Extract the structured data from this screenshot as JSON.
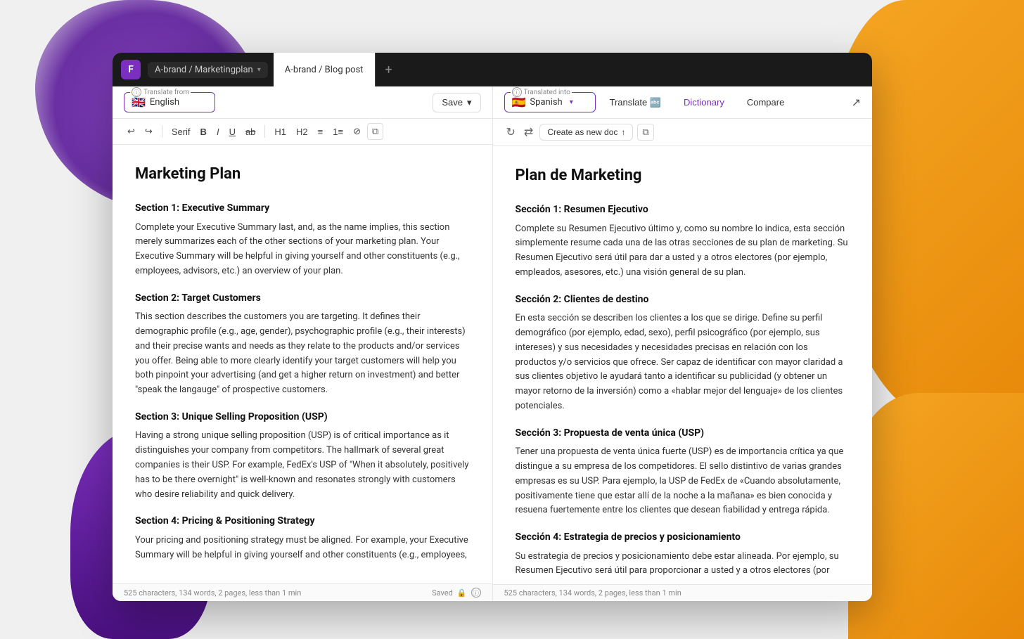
{
  "background": {
    "colors": {
      "purple": "#7B2FBE",
      "orange": "#F5A623",
      "dark": "#1a1a1a"
    }
  },
  "titleBar": {
    "logo": "F",
    "project": "A-brand / Marketingplan",
    "tabs": [
      {
        "label": "A-brand / Blog post",
        "active": true
      }
    ],
    "addTab": "+"
  },
  "leftPanel": {
    "toolbar": {
      "translateFrom": "Translate from",
      "languageFlag": "🇬🇧",
      "languageName": "English",
      "saveLabel": "Save",
      "infoIcon": "ⓘ"
    },
    "formatToolbar": {
      "undo": "↩",
      "redo": "↪",
      "fontLabel": "Serif",
      "bold": "B",
      "italic": "I",
      "underline": "U",
      "strikethrough": "S̶",
      "h1": "H1",
      "h2": "H2",
      "bulletList": "•≡",
      "numberedList": "1≡",
      "clearFormat": "✕",
      "copyFormat": "⧉"
    },
    "document": {
      "title": "Marketing Plan",
      "sections": [
        {
          "heading": "Section 1: Executive Summary",
          "text": "Complete your Executive Summary last, and, as the name implies, this section merely summarizes each of the other sections of your marketing plan. Your Executive Summary will be helpful in giving yourself and other constituents (e.g., employees, advisors, etc.) an overview of your plan."
        },
        {
          "heading": "Section 2: Target Customers",
          "text": "This section describes the customers you are targeting. It defines their demographic profile (e.g., age, gender), psychographic profile (e.g., their interests) and their precise wants and needs as they relate to the products and/or services you offer. Being able to more clearly identify your target customers will help you both pinpoint your advertising (and get a higher return on investment) and better \"speak the langauge\" of prospective customers."
        },
        {
          "heading": "Section 3: Unique Selling Proposition (USP)",
          "text": "Having a strong unique selling proposition (USP) is of critical importance as it distinguishes your company from competitors. The hallmark of several great companies is their USP. For example, FedEx's USP of \"When it absolutely, positively has to be there overnight\" is well-known and resonates strongly with customers who desire reliability and quick delivery."
        },
        {
          "heading": "Section 4: Pricing & Positioning Strategy",
          "text": "Your pricing and positioning strategy must be aligned. For example, your Executive Summary will be helpful in giving yourself and other constituents (e.g., employees,"
        }
      ]
    },
    "statusBar": {
      "stats": "525 characters, 134 words, 2 pages, less than 1 min",
      "savedLabel": "Saved",
      "lockIcon": "🔒"
    }
  },
  "rightPanel": {
    "toolbar": {
      "translatedInto": "Translated into",
      "languageFlag": "🇪🇸",
      "languageName": "Spanish",
      "translateLabel": "Translate",
      "translateIcon": "🔤",
      "dictionaryLabel": "Dictionary",
      "compareLabel": "Compare",
      "exportIcon": "↗",
      "infoIcon": "ⓘ"
    },
    "formatToolbar": {
      "refreshIcon": "↻",
      "syncIcon": "⇄",
      "createNewLabel": "Create as new doc",
      "uploadIcon": "↑",
      "copyIcon": "⧉"
    },
    "document": {
      "title": "Plan de Marketing",
      "sections": [
        {
          "heading": "Sección 1: Resumen Ejecutivo",
          "text": "Complete su Resumen Ejecutivo último y, como su nombre lo indica, esta sección simplemente resume cada una de las otras secciones de su plan de marketing. Su Resumen Ejecutivo será útil para dar a usted y a otros electores (por ejemplo, empleados, asesores, etc.) una visión general de su plan."
        },
        {
          "heading": "Sección 2: Clientes de destino",
          "text": "En esta sección se describen los clientes a los que se dirige. Define su perfil demográfico (por ejemplo, edad, sexo), perfil psicográfico (por ejemplo, sus intereses) y sus necesidades y necesidades precisas en relación con los productos y/o servicios que ofrece. Ser capaz de identificar con mayor claridad a sus clientes objetivo le ayudará tanto a identificar su publicidad (y obtener un mayor retorno de la inversión) como a «hablar mejor del lenguaje» de los clientes potenciales."
        },
        {
          "heading": "Sección 3: Propuesta de venta única (USP)",
          "text": "Tener una propuesta de venta única fuerte (USP) es de importancia crítica ya que distingue a su empresa de los competidores. El sello distintivo de varias grandes empresas es su USP. Para ejemplo, la USP de FedEx de «Cuando absolutamente, positivamente tiene que estar allí de la noche a la mañana» es bien conocida y resuena fuertemente entre los clientes que desean fiabilidad y entrega rápida."
        },
        {
          "heading": "Sección 4: Estrategia de precios y posicionamiento",
          "text": "Su estrategia de precios y posicionamiento debe estar alineada. Por ejemplo, su Resumen Ejecutivo será útil para proporcionar a usted y a otros electores (por"
        }
      ]
    },
    "statusBar": {
      "stats": "525 characters, 134 words, 2 pages, less than 1 min"
    }
  }
}
